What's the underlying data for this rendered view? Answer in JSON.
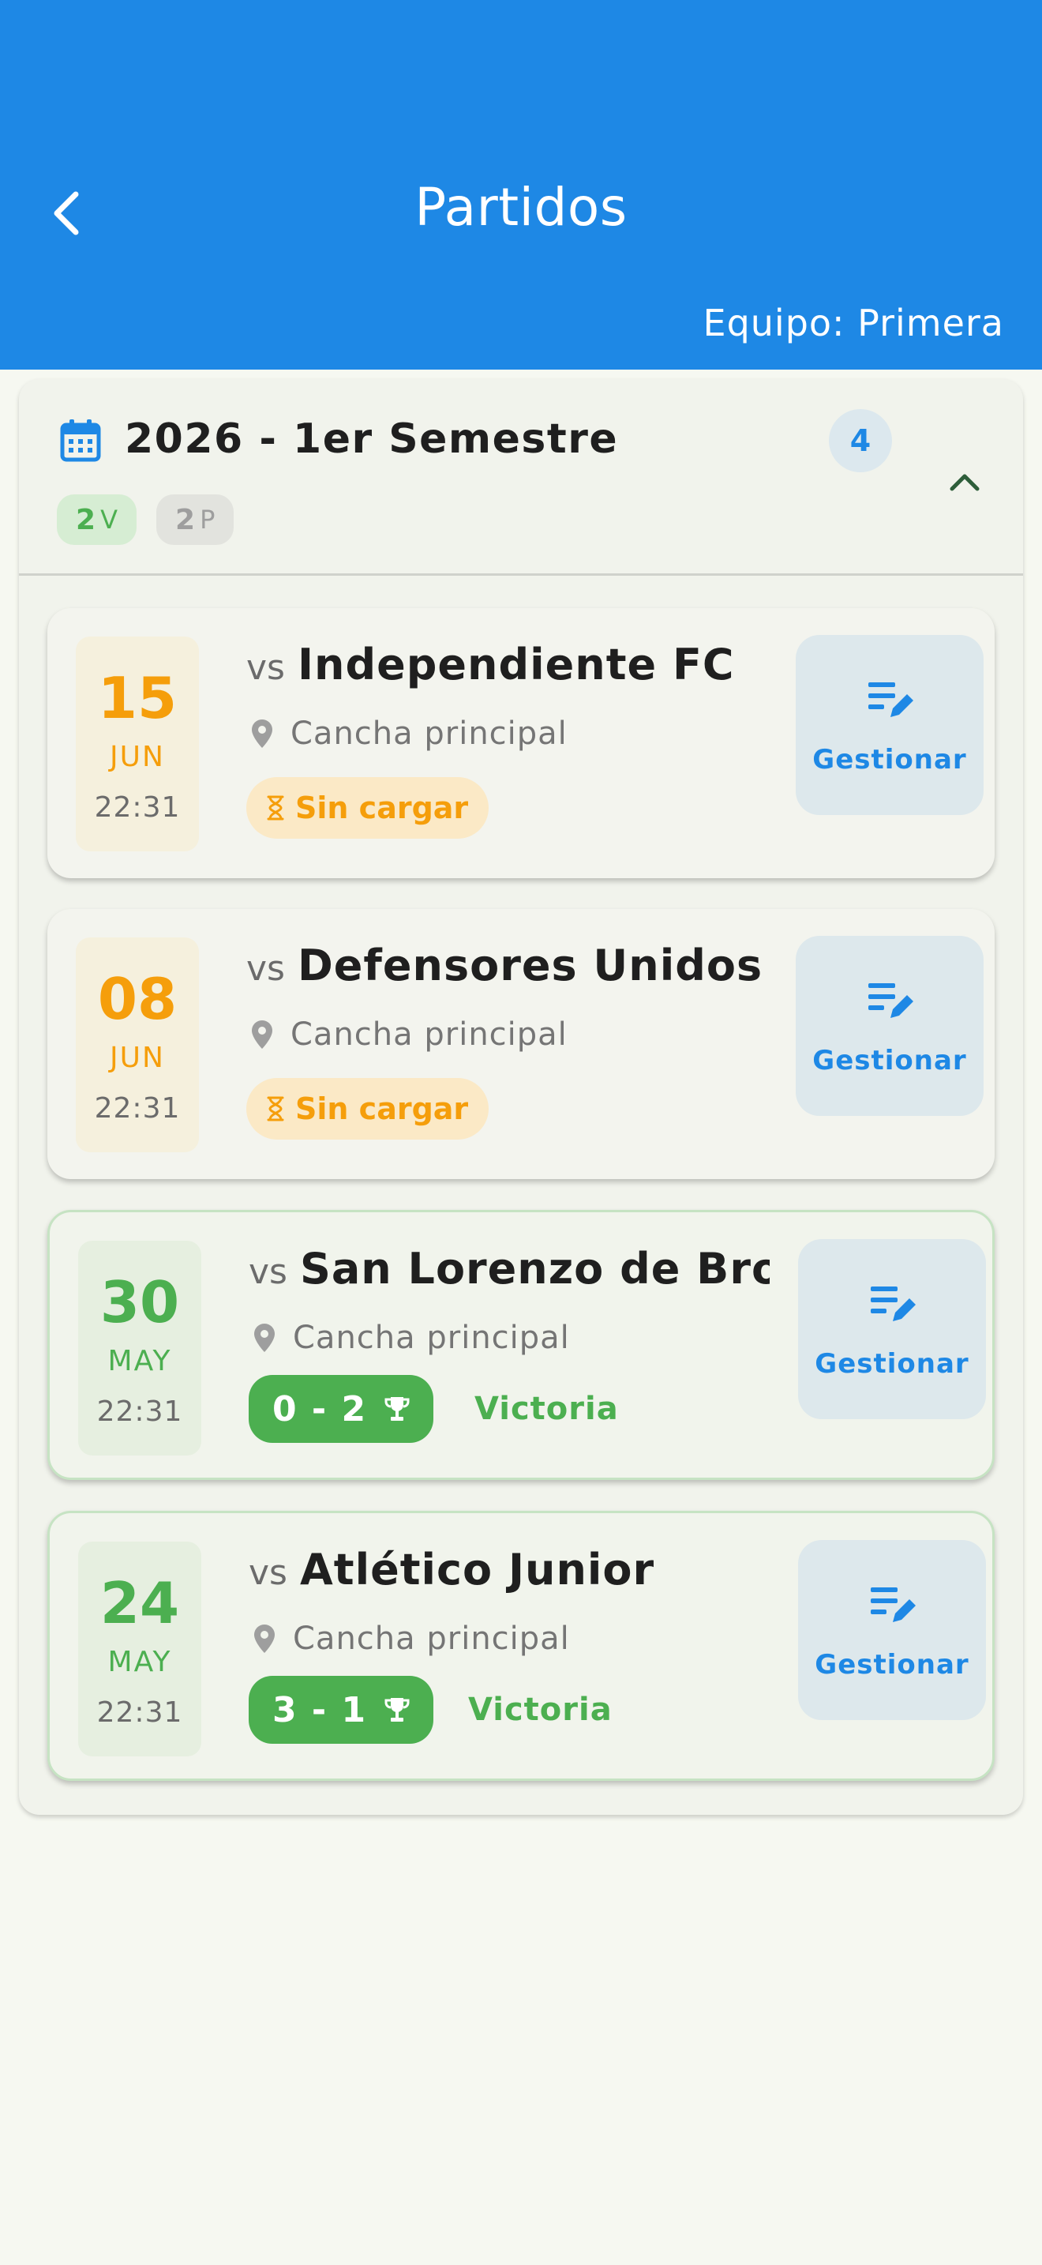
{
  "header": {
    "title": "Partidos",
    "team_label": "Equipo: Primera"
  },
  "colors": {
    "primary": "#1E88E5",
    "win": "#4CAF50",
    "pending": "#F59E0B",
    "neutral": "#9E9E9E"
  },
  "semester": {
    "title": "2026 - 1er Semestre",
    "count": "4",
    "wins_num": "2",
    "wins_letter": "V",
    "losses_num": "2",
    "losses_letter": "P",
    "expanded": true
  },
  "matches": [
    {
      "day": "15",
      "month": "JUN",
      "time": "22:31",
      "vs": "vs",
      "opponent": "Independiente FC",
      "venue": "Cancha principal",
      "status": "Sin cargar",
      "manage": "Gestionar"
    },
    {
      "day": "08",
      "month": "JUN",
      "time": "22:31",
      "vs": "vs",
      "opponent": "Defensores Unidos",
      "venue": "Cancha principal",
      "status": "Sin cargar",
      "manage": "Gestionar"
    },
    {
      "day": "30",
      "month": "MAY",
      "time": "22:31",
      "vs": "vs",
      "opponent": "San Lorenzo de Bro...",
      "venue": "Cancha principal",
      "score": "0 - 2",
      "result": "Victoria",
      "manage": "Gestionar"
    },
    {
      "day": "24",
      "month": "MAY",
      "time": "22:31",
      "vs": "vs",
      "opponent": "Atlético Junior",
      "venue": "Cancha principal",
      "score": "3 - 1",
      "result": "Victoria",
      "manage": "Gestionar"
    }
  ]
}
